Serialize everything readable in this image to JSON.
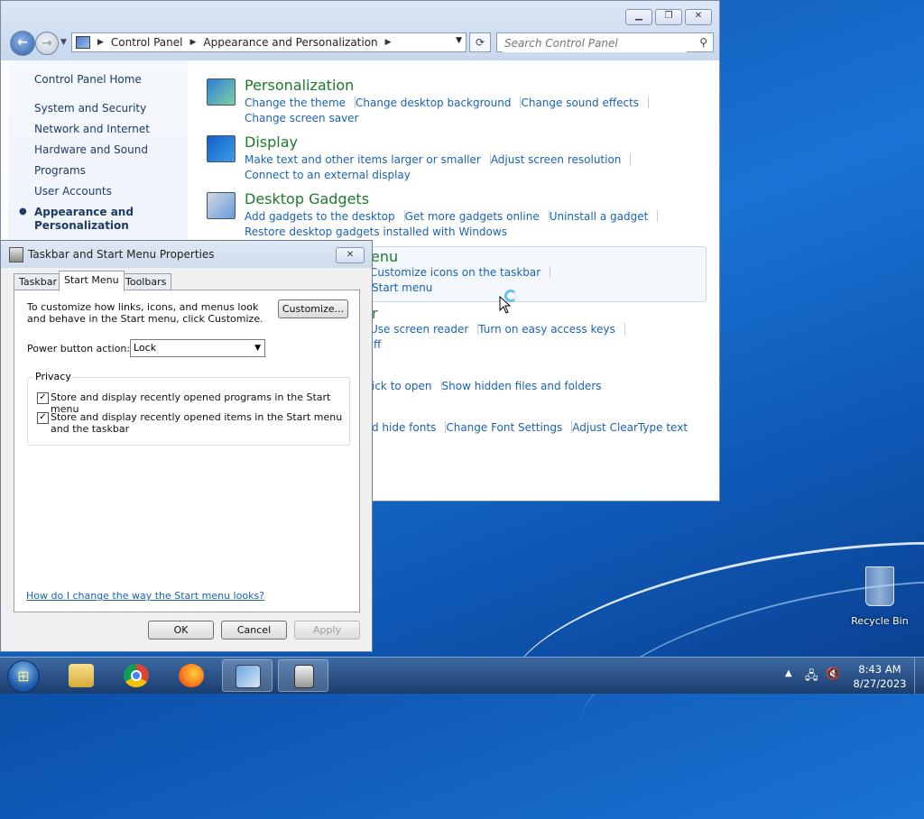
{
  "control_panel": {
    "breadcrumb": [
      "Control Panel",
      "Appearance and Personalization"
    ],
    "search_placeholder": "Search Control Panel",
    "left_nav": {
      "home": "Control Panel Home",
      "items": [
        "System and Security",
        "Network and Internet",
        "Hardware and Sound",
        "Programs",
        "User Accounts"
      ],
      "current_line1": "Appearance and",
      "current_line2": "Personalization"
    },
    "categories": {
      "personalization": {
        "title": "Personalization",
        "links": [
          "Change the theme",
          "Change desktop background",
          "Change sound effects",
          "Change screen saver"
        ]
      },
      "display": {
        "title": "Display",
        "links": [
          "Make text and other items larger or smaller",
          "Adjust screen resolution",
          "Connect to an external display"
        ]
      },
      "gadgets": {
        "title": "Desktop Gadgets",
        "links": [
          "Add gadgets to the desktop",
          "Get more gadgets online",
          "Uninstall a gadget",
          "Restore desktop gadgets installed with Windows"
        ]
      }
    },
    "partial": {
      "taskbar_title_frag": "enu",
      "taskbar_link": "Customize icons on the taskbar",
      "taskbar_link2_frag": "Start menu",
      "ease_title_frag": "r",
      "ease_links": [
        "Use screen reader",
        "Turn on easy access keys"
      ],
      "ease_frag": "ff",
      "folder_frag": "ick to open",
      "folder_link": "Show hidden files and folders",
      "fonts_frag": "d hide fonts",
      "fonts_links": [
        "Change Font Settings",
        "Adjust ClearType text"
      ]
    }
  },
  "dialog": {
    "title": "Taskbar and Start Menu Properties",
    "tabs": [
      "Taskbar",
      "Start Menu",
      "Toolbars"
    ],
    "active_tab": "Start Menu",
    "description": "To customize how links, icons, and menus look and behave in the Start menu, click Customize.",
    "customize_label": "Customize...",
    "power_label": "Power button action:",
    "power_value": "Lock",
    "privacy_title": "Privacy",
    "checkbox1": "Store and display recently opened programs in the Start menu",
    "checkbox1_checked": true,
    "checkbox2": "Store and display recently opened items in the Start menu and the taskbar",
    "checkbox2_checked": true,
    "help_link": "How do I change the way the Start menu looks?",
    "ok": "OK",
    "cancel": "Cancel",
    "apply": "Apply"
  },
  "desktop": {
    "recycle_bin": "Recycle Bin"
  },
  "taskbar": {
    "time": "8:43 AM",
    "date": "8/27/2023",
    "pinned": [
      "file-explorer",
      "chrome",
      "firefox",
      "control-panel",
      "taskbar-properties"
    ]
  },
  "colors": {
    "link": "#1a62b0",
    "category_title": "#1c7a2c",
    "taskbar": "#1b3d6e"
  }
}
